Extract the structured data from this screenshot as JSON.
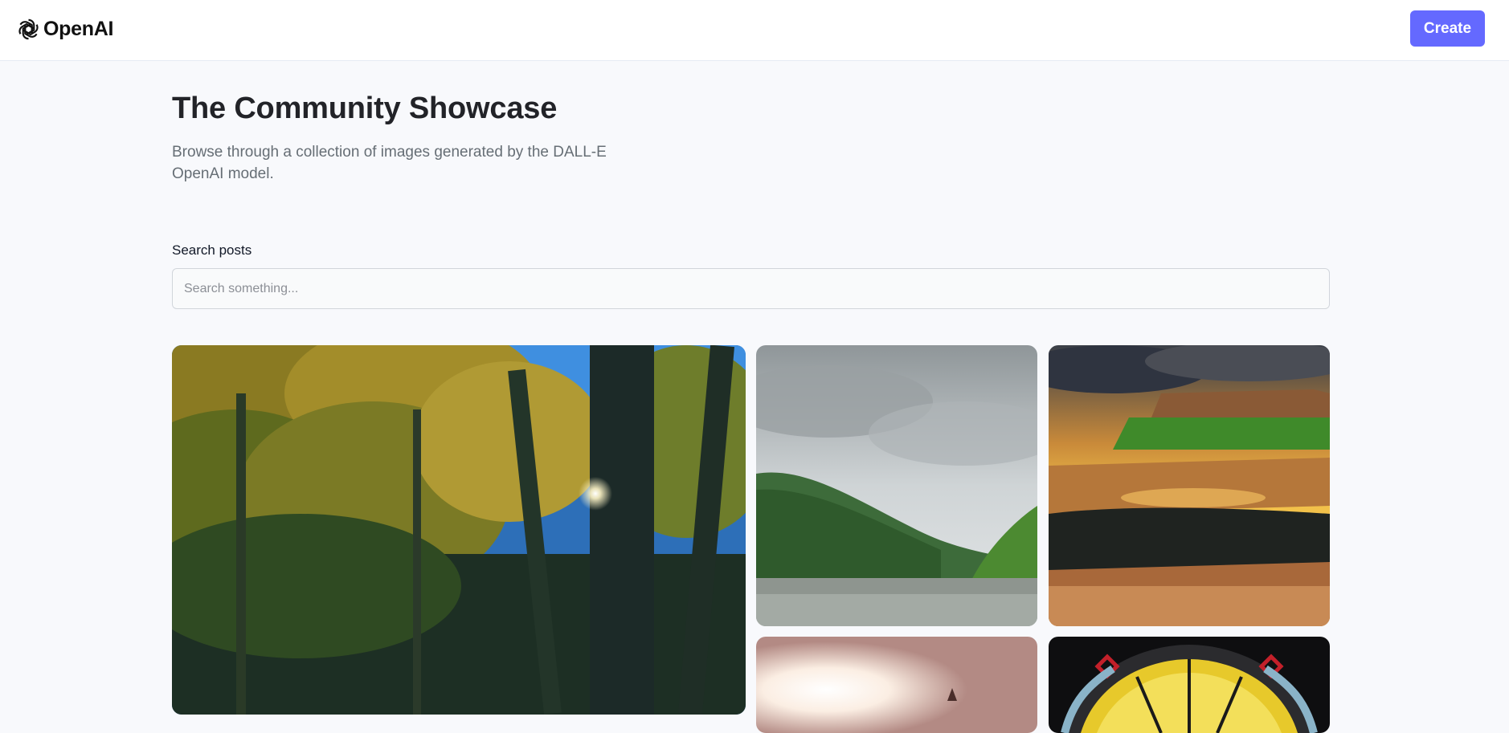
{
  "header": {
    "logo_text": "OpenAI",
    "logo_icon": "openai-logo-icon",
    "create_label": "Create",
    "accent_color": "#6469ff"
  },
  "main": {
    "title": "The Community Showcase",
    "subtitle": "Browse through a collection of images generated by the DALL-E OpenAI model."
  },
  "search": {
    "label": "Search posts",
    "placeholder": "Search something...",
    "value": ""
  },
  "gallery": {
    "cards": [
      {
        "description_icon": "forest-image"
      },
      {
        "description_icon": "mountain-lake-image"
      },
      {
        "description_icon": "rocky-sunset-image"
      },
      {
        "description_icon": "sunlight-figure-image"
      },
      {
        "description_icon": "stained-glass-image"
      }
    ]
  }
}
